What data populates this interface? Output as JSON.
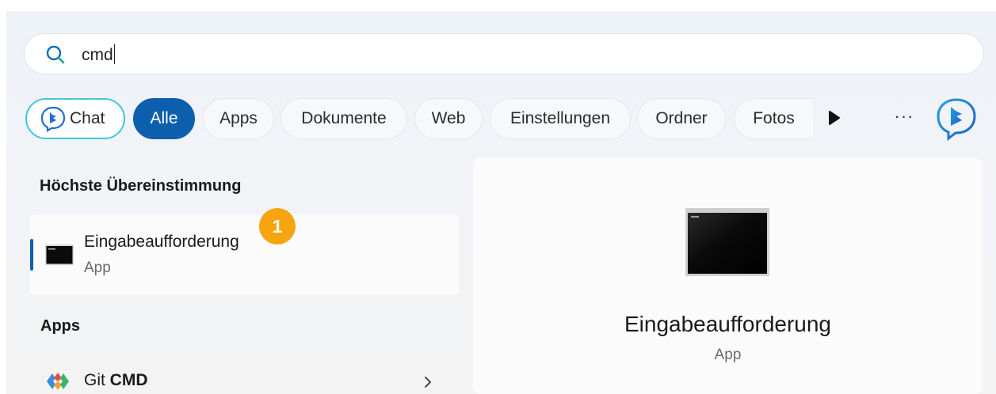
{
  "search": {
    "value": "cmd"
  },
  "filters": {
    "chat": "Chat",
    "items": [
      "Alle",
      "Apps",
      "Dokumente",
      "Web",
      "Einstellungen",
      "Ordner",
      "Fotos"
    ],
    "selected": "Alle",
    "more": "···"
  },
  "best_match": {
    "heading": "Höchste Übereinstimmung",
    "name": "Eingabeaufforderung",
    "type": "App",
    "badge": "1"
  },
  "apps": {
    "heading": "Apps",
    "items": [
      {
        "prefix": "Git ",
        "bold": "CMD"
      }
    ]
  },
  "preview": {
    "name": "Eingabeaufforderung",
    "type": "App"
  },
  "colors": {
    "accent": "#0d5fae",
    "chat_border": "#3fc7d6",
    "badge": "#f6a511"
  },
  "icons": [
    "search-icon",
    "bing-chat-icon",
    "play-icon",
    "more-icon",
    "bing-icon",
    "cmd-icon",
    "git-icon",
    "chevron-right-icon"
  ]
}
